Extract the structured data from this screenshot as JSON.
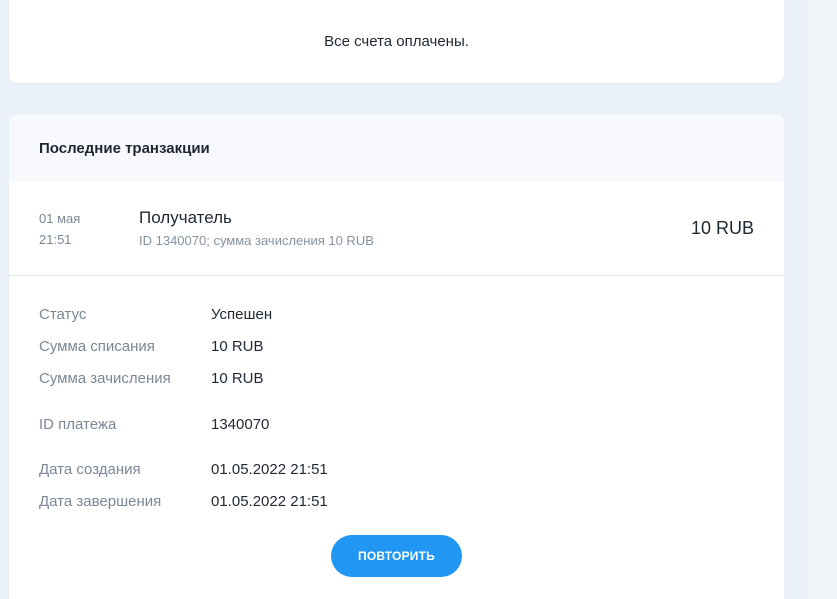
{
  "paid_notice": {
    "message": "Все счета оплачены."
  },
  "transactions": {
    "title": "Последние транзакции",
    "items": [
      {
        "date": "01 мая",
        "time": "21:51",
        "recipient": "Получатель",
        "subtitle": "ID 1340070; сумма зачисления 10 RUB",
        "amount": "10 RUB"
      }
    ],
    "details": {
      "status_label": "Статус",
      "status_value": "Успешен",
      "debit_label": "Сумма списания",
      "debit_value": "10 RUB",
      "credit_label": "Сумма зачисления",
      "credit_value": "10 RUB",
      "payment_id_label": "ID платежа",
      "payment_id_value": "1340070",
      "created_label": "Дата создания",
      "created_value": "01.05.2022 21:51",
      "completed_label": "Дата завершения",
      "completed_value": "01.05.2022 21:51"
    },
    "repeat_button": "ПОВТОРИТЬ"
  },
  "colors": {
    "accent": "#2196f3",
    "background": "#ebf1fa",
    "card": "#ffffff",
    "muted_text": "#7a8797"
  }
}
